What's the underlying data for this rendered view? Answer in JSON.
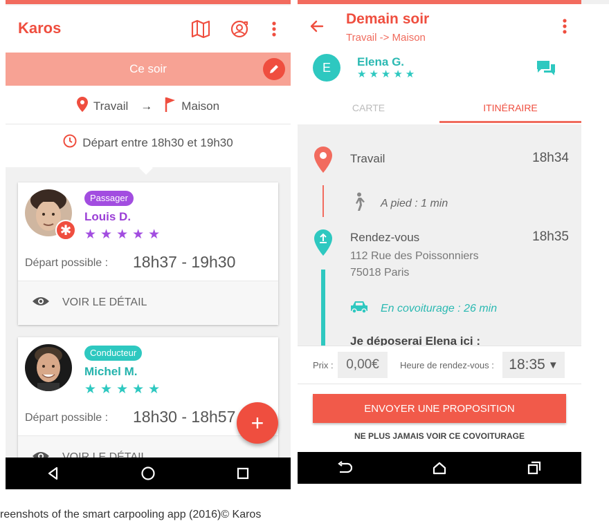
{
  "left_screen": {
    "app_name": "Karos",
    "banner_title": "Ce soir",
    "route": {
      "from": "Travail",
      "arrow": "→",
      "to": "Maison"
    },
    "departure_window": "Départ entre 18h30 et 19h30",
    "cards": [
      {
        "role": "Passager",
        "role_color": "#a24de0",
        "name": "Louis D.",
        "name_color": "#9b3fd6",
        "stars": "★★★★★",
        "depart_label": "Départ possible :",
        "depart_value": "18h37 - 19h30",
        "detail_label": "VOIR LE DÉTAIL"
      },
      {
        "role": "Conducteur",
        "role_color": "#2ec8c0",
        "name": "Michel M.",
        "name_color": "#24b3ac",
        "stars": "★★★★★",
        "depart_label": "Départ possible :",
        "depart_value": "18h30 - 18h57",
        "detail_label": "VOIR LE DÉTAIL"
      }
    ],
    "fab_label": "+"
  },
  "right_screen": {
    "title": "Demain soir",
    "subtitle": "Travail -> Maison",
    "driver": {
      "initial": "E",
      "name": "Elena G.",
      "stars": "★★★★★"
    },
    "tabs": [
      {
        "label": "CARTE",
        "active": false
      },
      {
        "label": "ITINÉRAIRE",
        "active": true
      }
    ],
    "itinerary": {
      "start_place": "Travail",
      "start_time": "18h34",
      "walk_text": "A pied : 1 min",
      "meet_title": "Rendez-vous",
      "meet_time": "18h35",
      "meet_address_1": "112 Rue des Poissonniers",
      "meet_address_2": "75018 Paris",
      "carpool_text": "En covoiturage : 26 min",
      "dropoff_text": "Je déposerai Elena ici :"
    },
    "price": {
      "label": "Prix :",
      "value": "0,00€"
    },
    "meeting_time": {
      "label": "Heure de rendez-vous :",
      "value": "18:35",
      "arrow": "▼"
    },
    "send_button": "ENVOYER UNE PROPOSITION",
    "never_link": "NE PLUS JAMAIS VOIR CE COVOITURAGE"
  },
  "caption": "reenshots of the smart carpooling app (2016)© Karos",
  "colors": {
    "brand_red": "#ef4e3f",
    "banner_salmon": "#f7a294",
    "teal": "#2ec8c0",
    "purple": "#a24de0"
  },
  "icons": [
    "map-icon",
    "profile-switch-icon",
    "more-vert-icon",
    "edit-pencil-icon",
    "location-pin-icon",
    "flag-icon",
    "clock-icon",
    "eye-icon",
    "back-arrow-icon",
    "chat-icon",
    "walking-icon",
    "car-icon",
    "nav-back-icon",
    "nav-home-icon",
    "nav-recents-icon"
  ]
}
